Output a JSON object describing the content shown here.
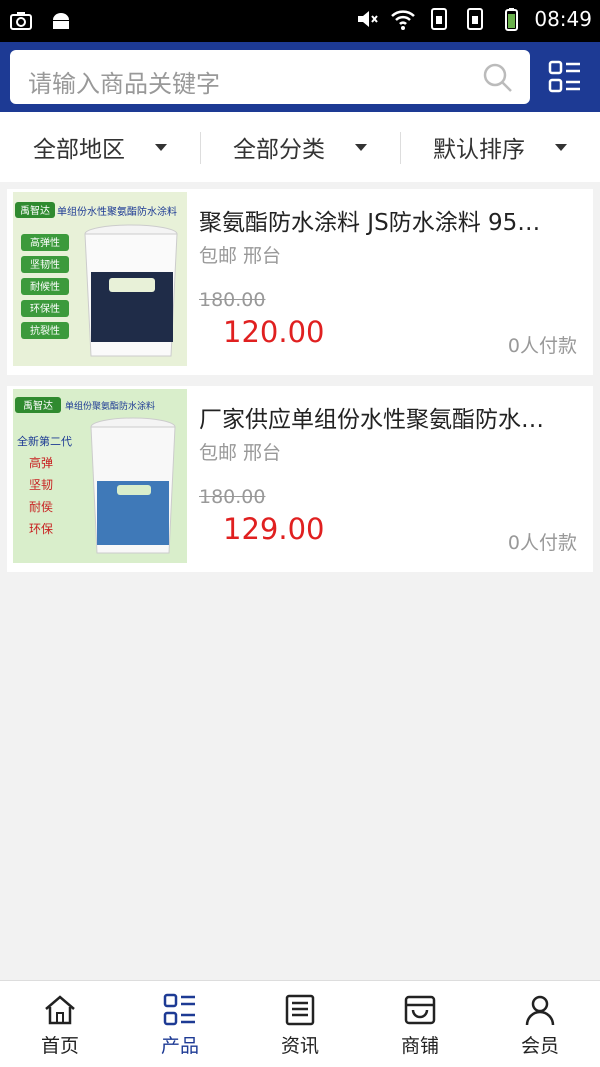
{
  "status_bar": {
    "time": "08:49"
  },
  "search": {
    "placeholder": "请输入商品关键字"
  },
  "filters": [
    {
      "label": "全部地区"
    },
    {
      "label": "全部分类"
    },
    {
      "label": "默认排序"
    }
  ],
  "products": [
    {
      "title": "聚氨酯防水涂料 JS防水涂料 95…",
      "meta": "包邮 邢台",
      "old_price": "180.00",
      "price": "120.00",
      "paid": "0人付款",
      "image": {
        "brand": "禹智达",
        "headline": "单组份水性聚氨酯防水涂料",
        "features": [
          "高弹性",
          "坚韧性",
          "耐候性",
          "环保性",
          "抗裂性"
        ]
      }
    },
    {
      "title": "厂家供应单组份水性聚氨酯防水…",
      "meta": "包邮 邢台",
      "old_price": "180.00",
      "price": "129.00",
      "paid": "0人付款",
      "image": {
        "brand": "禹智达",
        "headline": "单组份聚氨酯防水涂料",
        "tag": "全新第二代",
        "features": [
          "高弹",
          "坚韧",
          "耐侯",
          "环保"
        ]
      }
    }
  ],
  "tabbar": [
    {
      "label": "首页",
      "icon": "home-icon"
    },
    {
      "label": "产品",
      "icon": "list-icon",
      "active": true
    },
    {
      "label": "资讯",
      "icon": "news-icon"
    },
    {
      "label": "商铺",
      "icon": "shop-icon"
    },
    {
      "label": "会员",
      "icon": "user-icon"
    }
  ],
  "colors": {
    "primary": "#1d3a94",
    "price": "#e02020"
  }
}
